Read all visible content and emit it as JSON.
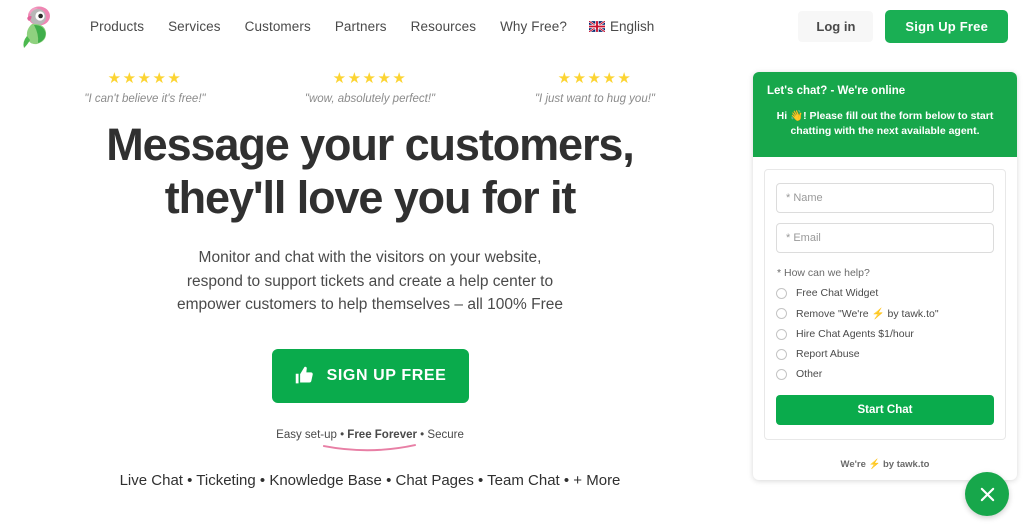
{
  "header": {
    "logo_icon": "parrot-logo-icon",
    "nav_items": [
      {
        "label": "Products"
      },
      {
        "label": "Services"
      },
      {
        "label": "Customers"
      },
      {
        "label": "Partners"
      },
      {
        "label": "Resources"
      },
      {
        "label": "Why Free?"
      }
    ],
    "language": {
      "label": "English",
      "flag_icon": "uk-flag-icon"
    },
    "login_label": "Log in",
    "signup_label": "Sign Up Free"
  },
  "hero": {
    "testimonials": [
      {
        "stars": "★★★★★",
        "quote": "\"I can't believe it's free!\""
      },
      {
        "stars": "★★★★★",
        "quote": "\"wow, absolutely perfect!\""
      },
      {
        "stars": "★★★★★",
        "quote": "\"I just want to hug you!\""
      }
    ],
    "headline_line1": "Message your customers,",
    "headline_line2": "they'll love you for it",
    "subhead_line1": "Monitor and chat with the visitors on your website,",
    "subhead_line2": "respond to support tickets and create a help center to",
    "subhead_line3": "empower customers to help themselves – all 100% Free",
    "cta_label": "SIGN UP FREE",
    "cta_icon": "thumbs-up-icon",
    "fineprint_pre": "Easy set-up • ",
    "fineprint_bold": "Free Forever",
    "fineprint_post": " • Secure",
    "features": "Live Chat • Ticketing • Knowledge Base • Chat Pages • Team Chat • + More"
  },
  "chat_widget": {
    "title": "Let's chat? - We're online",
    "greeting": "Hi 👋! Please fill out the form below to start chatting with the next available agent.",
    "name_placeholder": "* Name",
    "email_placeholder": "* Email",
    "name_value": "",
    "email_value": "",
    "help_label": "* How can we help?",
    "options": [
      {
        "label": "Free Chat Widget",
        "selected": false
      },
      {
        "label": "Remove \"We're ⚡ by tawk.to\"",
        "selected": false
      },
      {
        "label": "Hire Chat Agents $1/hour",
        "selected": false
      },
      {
        "label": "Report Abuse",
        "selected": false
      },
      {
        "label": "Other",
        "selected": false
      }
    ],
    "start_label": "Start Chat",
    "footer": "We're ⚡ by tawk.to",
    "close_icon": "close-icon"
  },
  "colors": {
    "brand_green": "#0aab4c",
    "widget_green": "#17a74b",
    "star_yellow": "#fcd433",
    "heading_dark": "#303030",
    "swoosh_pink": "#e87fa5"
  }
}
